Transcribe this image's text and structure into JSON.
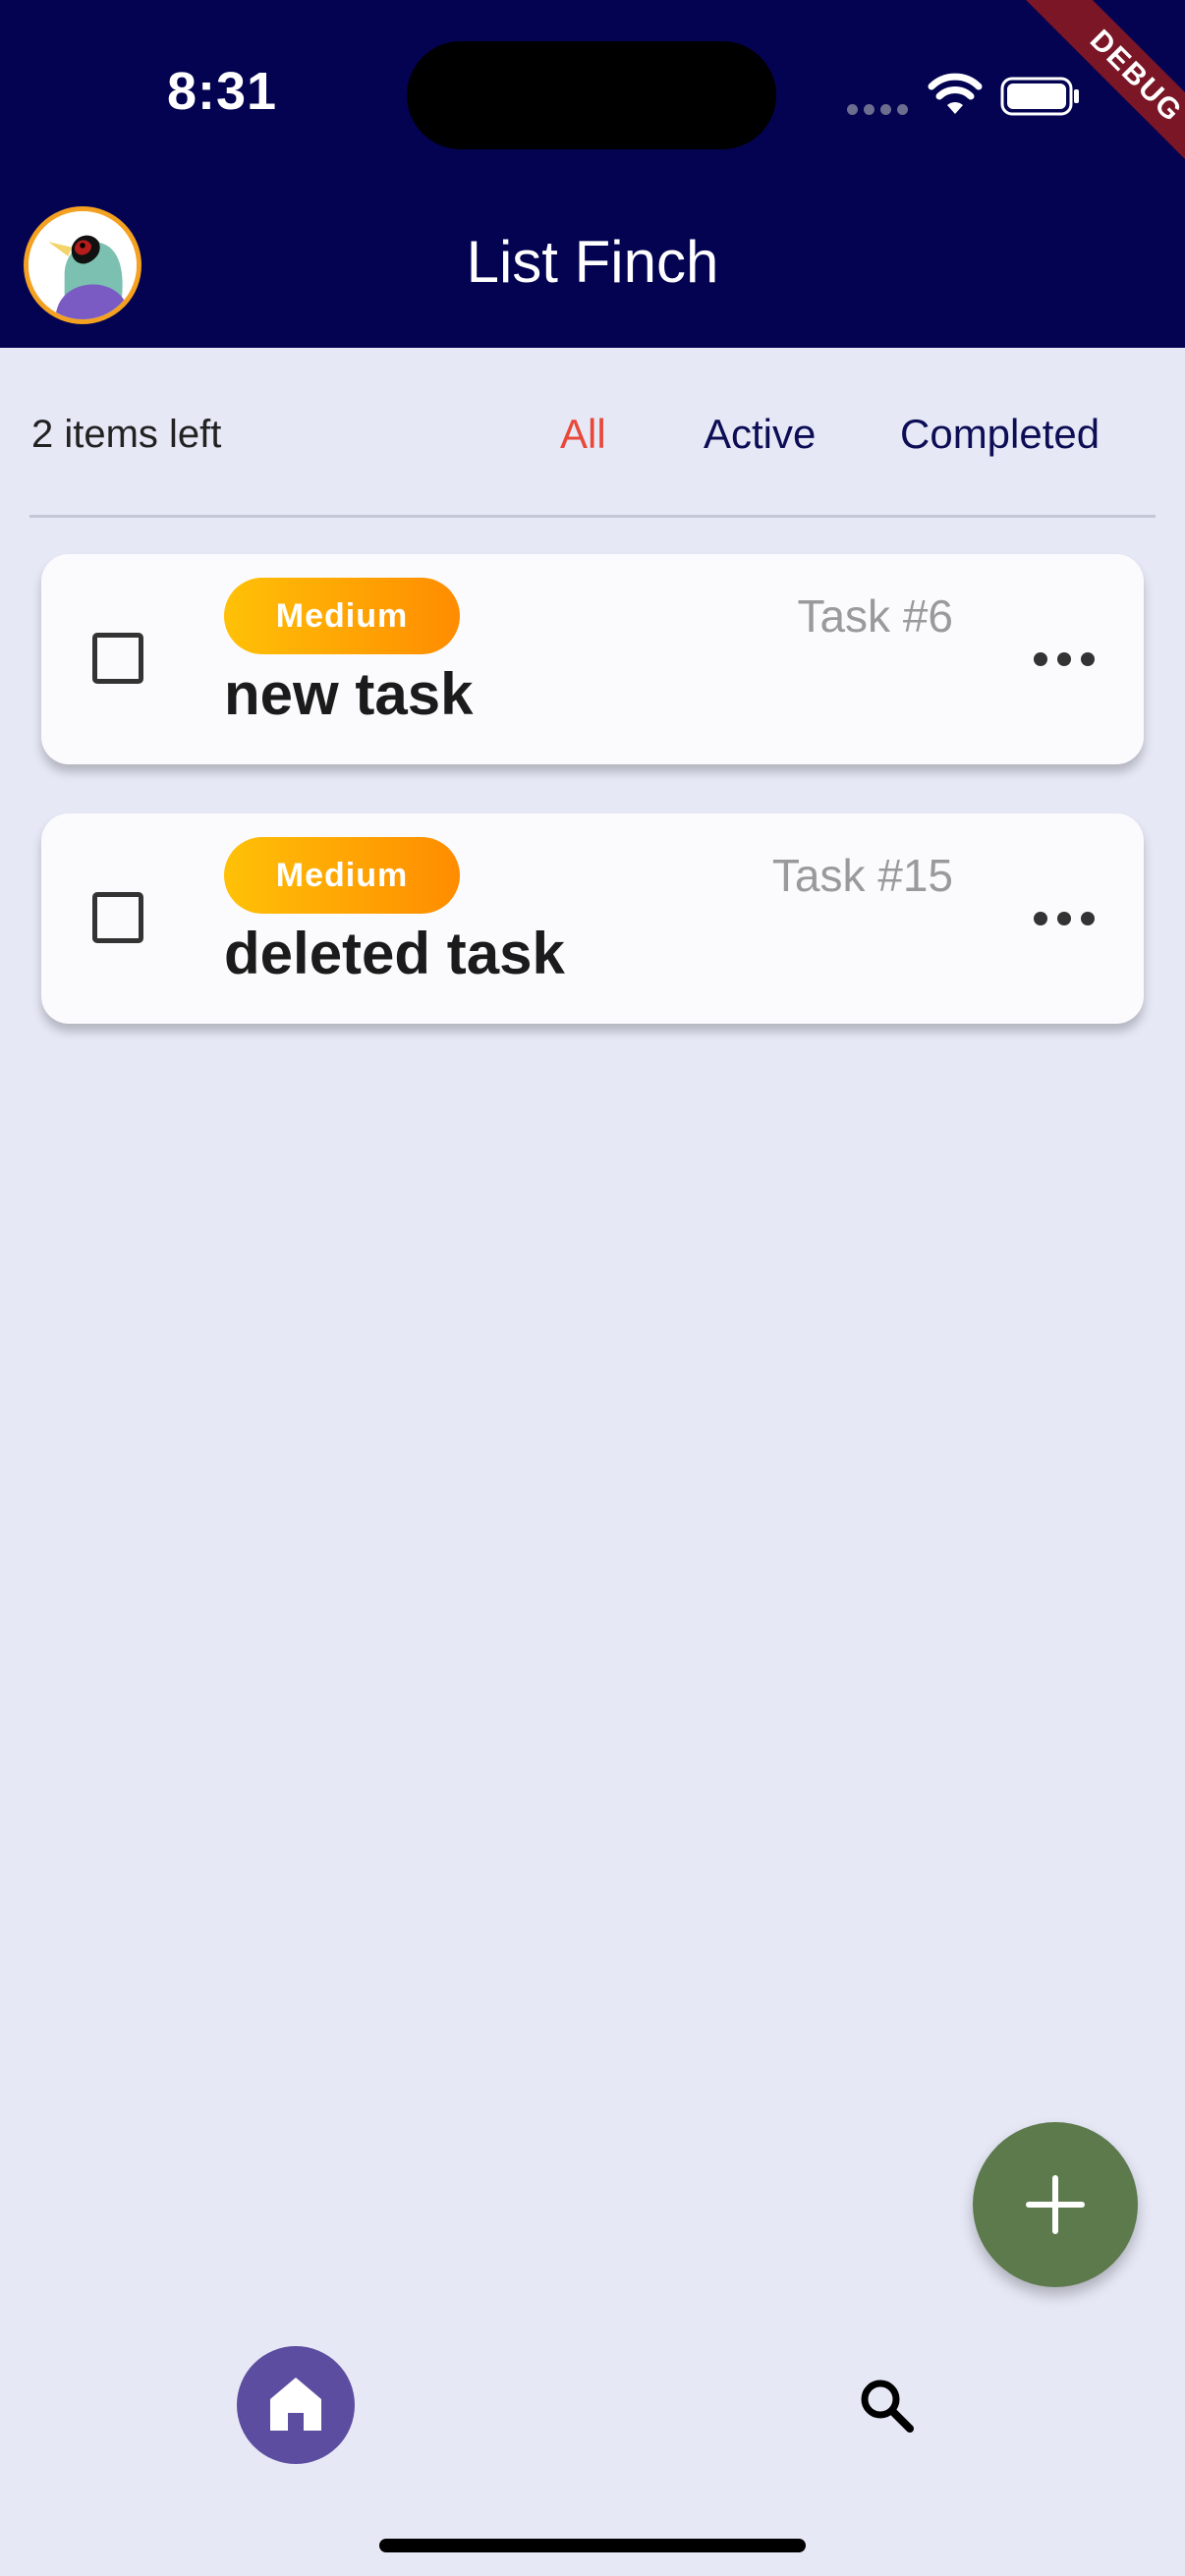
{
  "status_bar": {
    "time": "8:31"
  },
  "debug_banner": "DEBUG",
  "header": {
    "title": "List Finch"
  },
  "filter_bar": {
    "items_left": "2 items left",
    "filters": [
      "All",
      "Active",
      "Completed"
    ],
    "selected": "All"
  },
  "tasks": [
    {
      "priority": "Medium",
      "number": "Task #6",
      "title": "new task",
      "completed": false
    },
    {
      "priority": "Medium",
      "number": "Task #15",
      "title": "deleted task",
      "completed": false
    }
  ],
  "colors": {
    "header_bg": "#030352",
    "page_bg": "#e6e8f6",
    "filter_active": "#e8483a",
    "filter_inactive": "#0d0d55",
    "badge_gradient_start": "#ffc107",
    "badge_gradient_end": "#ff8c00",
    "fab_bg": "#5c7a4c",
    "nav_home_bg": "#5d4da0",
    "avatar_ring": "#f4a020"
  },
  "icons": {
    "avatar": "finch-avatar",
    "fab": "plus-icon",
    "nav_home": "home-icon",
    "nav_search": "search-icon",
    "task_menu": "more-horizontal-icon",
    "status": [
      "wifi-icon",
      "battery-icon"
    ]
  }
}
